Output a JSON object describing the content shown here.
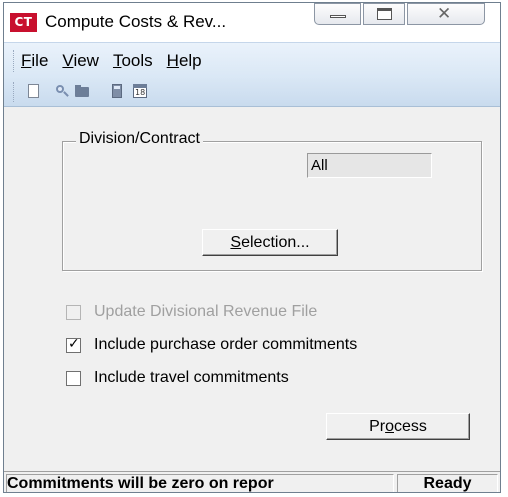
{
  "window": {
    "app_icon_text": "CT",
    "title": "Compute Costs & Rev..."
  },
  "menu": {
    "items": [
      {
        "label_access": "F",
        "label_rest": "ile"
      },
      {
        "label_access": "V",
        "label_rest": "iew"
      },
      {
        "label_access": "T",
        "label_rest": "ools"
      },
      {
        "label_access": "H",
        "label_rest": "elp"
      }
    ]
  },
  "toolbar": {
    "icons": [
      "new-document-icon",
      "search-icon",
      "folder-icon",
      "calculator-icon",
      "calendar-icon"
    ],
    "calendar_number": "18"
  },
  "division": {
    "group_label": "Division/Contract",
    "value": "All",
    "selection_button_access": "S",
    "selection_button_rest": "election..."
  },
  "options": {
    "update_divisional_revenue": {
      "label": "Update Divisional Revenue File",
      "checked": false,
      "enabled": false
    },
    "include_po_commitments": {
      "label": "Include purchase order commitments",
      "checked": true,
      "enabled": true
    },
    "include_travel_commitments": {
      "label": "Include travel commitments",
      "checked": false,
      "enabled": true
    }
  },
  "process_button": {
    "pre": "Pr",
    "access": "o",
    "post": "cess"
  },
  "status": {
    "message": "Commitments will be zero on repor",
    "state": "Ready"
  }
}
